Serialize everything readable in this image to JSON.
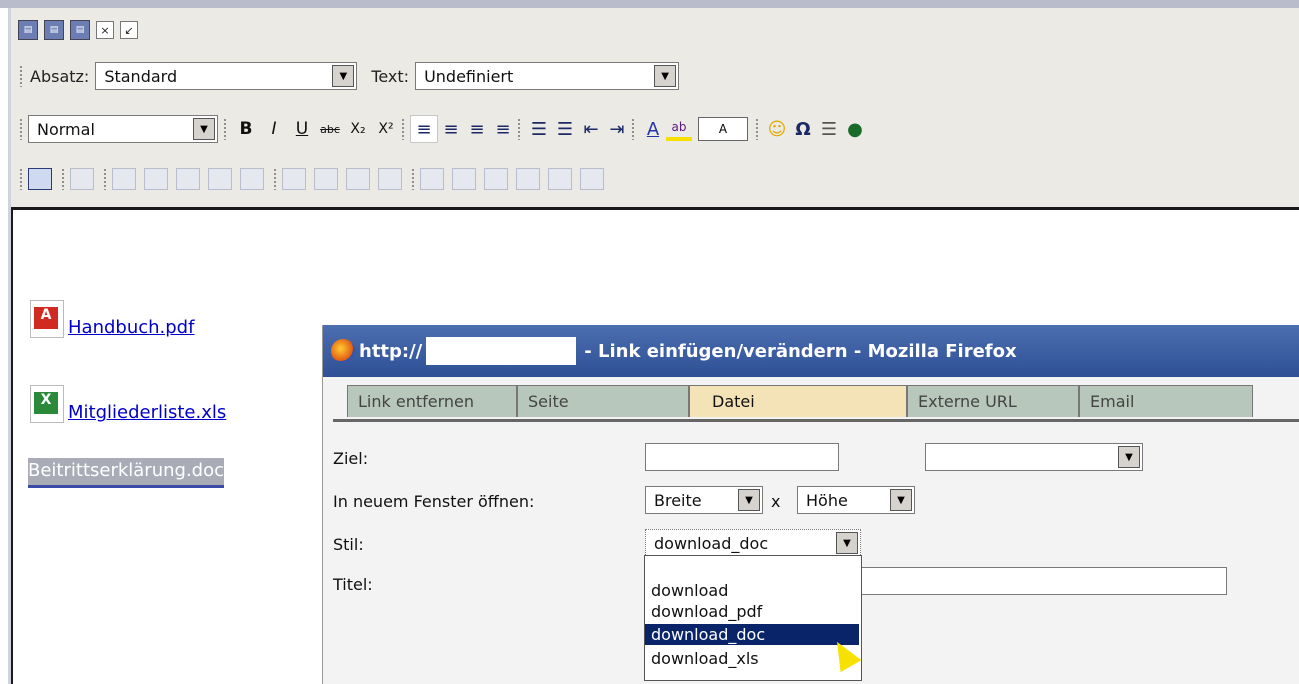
{
  "toolbar": {
    "row1_buttons": [
      "save-icon",
      "save-view-icon",
      "save-close-icon",
      "close-icon",
      "undo-icon"
    ],
    "absatz_label": "Absatz:",
    "absatz_value": "Standard",
    "text_label": "Text:",
    "text_value": "Undefiniert",
    "format_value": "Normal",
    "bold": "B",
    "italic": "I",
    "underline": "U",
    "strike": "abc",
    "sub": "X₂",
    "sup": "X²",
    "textcolor": "A",
    "bgcolor": "ab",
    "omega": "Ω"
  },
  "editor": {
    "files": [
      {
        "name": "Handbuch.pdf",
        "icon": "pdf-icon"
      },
      {
        "name": "Mitgliederliste.xls",
        "icon": "xls-icon"
      }
    ],
    "selected_text": "Beitrittserklärung.doc"
  },
  "popup": {
    "url_prefix": "http://",
    "title": "- Link einfügen/verändern - Mozilla Firefox",
    "tabs": [
      "Link entfernen",
      "Seite",
      "Datei",
      "Externe URL",
      "Email"
    ],
    "active_tab": "Datei",
    "ziel_label": "Ziel:",
    "neues_fenster_label": "In neuem Fenster öffnen:",
    "breite": "Breite",
    "x_sep": "x",
    "hoehe": "Höhe",
    "stil_label": "Stil:",
    "stil_value": "download_doc",
    "titel_label": "Titel:",
    "titel_fragment": ".",
    "options": [
      "download",
      "download_pdf",
      "download_doc",
      "download_xls"
    ],
    "selected_option": "download_doc"
  }
}
